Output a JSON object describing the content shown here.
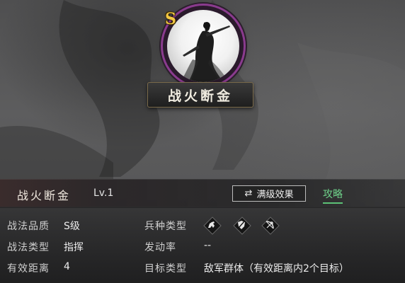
{
  "skill": {
    "grade": "S",
    "name": "战火断金",
    "level": "Lv.1",
    "max_level_button": "满级效果",
    "guide_link": "攻略"
  },
  "attributes": {
    "quality_label": "战法品质",
    "quality_value": "S级",
    "type_label": "战法类型",
    "type_value": "指挥",
    "range_label": "有效距离",
    "range_value": "4",
    "troop_label": "兵种类型",
    "troop_icons": [
      "cavalry-icon",
      "shield-icon",
      "bow-icon"
    ],
    "trigger_label": "发动率",
    "trigger_value": "--",
    "target_label": "目标类型",
    "target_value": "敌军群体（有效距离内2个目标）"
  },
  "colors": {
    "grade_gold": "#f2c744",
    "portrait_ring": "#8a3b8e",
    "guide_green": "#6fd28a"
  }
}
